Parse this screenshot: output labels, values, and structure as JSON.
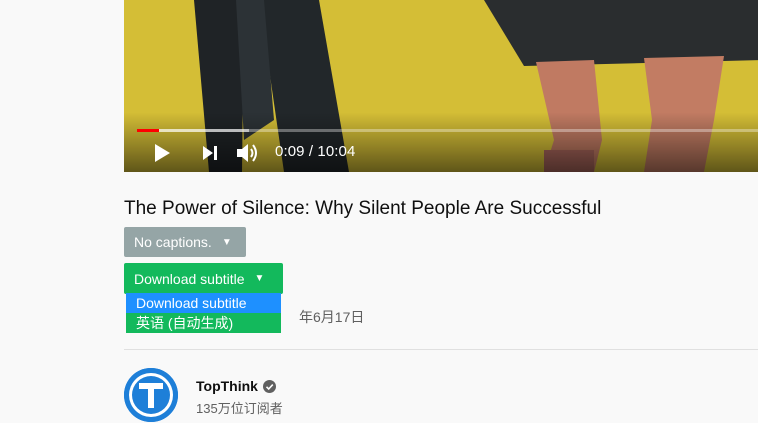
{
  "player": {
    "time_display": "0:09 / 10:04",
    "played_fraction": 0.036,
    "buffered_fraction": 0.18,
    "icons": [
      "play-icon",
      "next-icon",
      "volume-icon"
    ]
  },
  "video": {
    "title": "The Power of Silence: Why Silent People Are Successful",
    "date_visible": "年6月17日"
  },
  "captions_button": {
    "label": "No captions.",
    "caret": "▼"
  },
  "download": {
    "label": "Download subtitle",
    "caret": "▼",
    "options": [
      "Download subtitle",
      "英语 (自动生成)"
    ]
  },
  "channel": {
    "name": "TopThink",
    "subscribers": "135万位订阅者",
    "avatar_letter": "T",
    "verified_icon": "verified-check-icon"
  },
  "colors": {
    "accent_red": "#ff0000",
    "caption_button": "#95a5a6",
    "download_button": "#13b95c",
    "dropdown_highlight": "#1e90ff",
    "avatar_blue": "#1e7fd8"
  }
}
